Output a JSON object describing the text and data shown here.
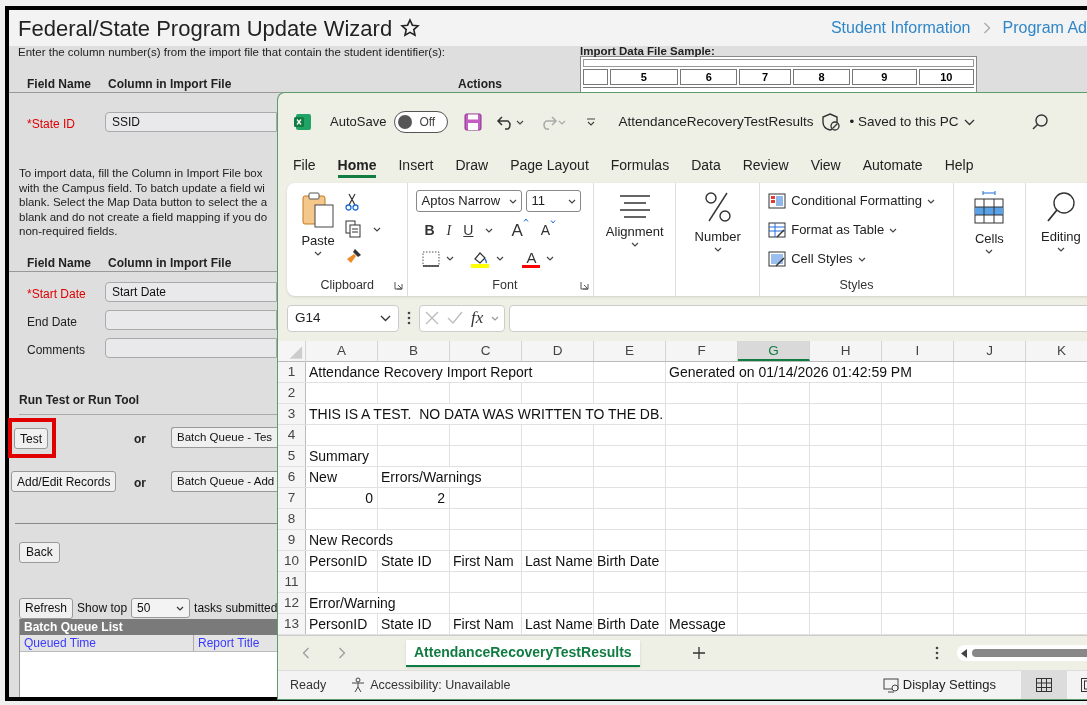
{
  "page": {
    "title": "Federal/State Program Update Wizard",
    "breadcrumb": [
      "Student Information",
      "Program Ad"
    ]
  },
  "intro": "Enter the column number(s) from the import file that contain the student identifier(s):",
  "sample": {
    "title": "Import Data File Sample:",
    "columns": [
      "5",
      "6",
      "7",
      "8",
      "9",
      "10"
    ]
  },
  "identifier_section": {
    "headers": [
      "Field Name",
      "Column in Import File",
      "Actions"
    ],
    "fields": [
      {
        "label": "*State ID",
        "required": true,
        "value": "SSID"
      }
    ]
  },
  "instructions": [
    "To import data, fill the Column in Import File box",
    "with the Campus field. To batch update a field wi",
    "blank. Select the Map Data button to select the a",
    "blank and do not create a field mapping if you do",
    "non-required fields."
  ],
  "mapping_section": {
    "headers": [
      "Field Name",
      "Column in Import File"
    ],
    "fields": [
      {
        "label": "*Start Date",
        "required": true,
        "value": "Start Date"
      },
      {
        "label": "End Date",
        "required": false
      },
      {
        "label": "Comments",
        "required": false
      }
    ]
  },
  "run_section": {
    "title": "Run Test or Run Tool",
    "rows": [
      {
        "button": "Test",
        "highlighted": true,
        "separator": "or",
        "batch_button": "Batch Queue - Tes"
      },
      {
        "button": "Add/Edit Records",
        "highlighted": false,
        "separator": "or",
        "batch_button": "Batch Queue - Add"
      }
    ]
  },
  "back_button": "Back",
  "queue": {
    "refresh": "Refresh",
    "show_top": "Show top",
    "count": "50",
    "suffix": "tasks submitted",
    "title": "Batch Queue List",
    "columns": [
      "Queued Time",
      "Report Title"
    ]
  },
  "excel": {
    "autosave": {
      "label": "AutoSave",
      "on": false,
      "state_text": "Off"
    },
    "filename": "AttendanceRecoveryTestResults",
    "save_status": "• Saved to this PC",
    "tabs": [
      {
        "label": "File",
        "selected": false
      },
      {
        "label": "Home",
        "selected": true
      },
      {
        "label": "Insert",
        "selected": false
      },
      {
        "label": "Draw",
        "selected": false
      },
      {
        "label": "Page Layout",
        "selected": false
      },
      {
        "label": "Formulas",
        "selected": false
      },
      {
        "label": "Data",
        "selected": false
      },
      {
        "label": "Review",
        "selected": false
      },
      {
        "label": "View",
        "selected": false
      },
      {
        "label": "Automate",
        "selected": false
      },
      {
        "label": "Help",
        "selected": false
      }
    ],
    "ribbon": {
      "paste": "Paste",
      "clipboard": "Clipboard",
      "font_name": "Aptos Narrow",
      "font_size": "11",
      "format_buttons": [
        "B",
        "I",
        "U"
      ],
      "grow": "A",
      "shrink": "A",
      "font_color": "A",
      "font": "Font",
      "alignment": "Alignment",
      "number": "Number",
      "styles_items": [
        "Conditional Formatting",
        "Format as Table",
        "Cell Styles"
      ],
      "styles": "Styles",
      "cells": "Cells",
      "editing": "Editing"
    },
    "name_box": "G14",
    "function_label": "fx",
    "columns": [
      {
        "letter": "A",
        "selected": false
      },
      {
        "letter": "B",
        "selected": false
      },
      {
        "letter": "C",
        "selected": false
      },
      {
        "letter": "D",
        "selected": false
      },
      {
        "letter": "E",
        "selected": false
      },
      {
        "letter": "F",
        "selected": false
      },
      {
        "letter": "G",
        "selected": true
      },
      {
        "letter": "H",
        "selected": false
      },
      {
        "letter": "I",
        "selected": false
      },
      {
        "letter": "J",
        "selected": false
      },
      {
        "letter": "K",
        "selected": false
      }
    ],
    "rows": [
      {
        "number": "1",
        "cells": {
          "A": {
            "text": "Attendance Recovery Import Report",
            "kind": "text"
          },
          "F": {
            "text": "Generated on 01/14/2026 01:42:59 PM",
            "kind": "text"
          }
        }
      },
      {
        "number": "2",
        "cells": {}
      },
      {
        "number": "3",
        "cells": {
          "A": {
            "text": "THIS IS A TEST.  NO DATA WAS WRITTEN TO THE DB.",
            "kind": "text"
          }
        }
      },
      {
        "number": "4",
        "cells": {}
      },
      {
        "number": "5",
        "cells": {
          "A": {
            "text": "Summary",
            "kind": "text"
          }
        }
      },
      {
        "number": "6",
        "cells": {
          "A": {
            "text": "New",
            "kind": "text"
          },
          "B": {
            "text": "Errors/Warnings",
            "kind": "text"
          }
        }
      },
      {
        "number": "7",
        "cells": {
          "A": {
            "text": "0",
            "kind": "number"
          },
          "B": {
            "text": "2",
            "kind": "number"
          }
        }
      },
      {
        "number": "8",
        "cells": {}
      },
      {
        "number": "9",
        "cells": {
          "A": {
            "text": "New Records",
            "kind": "text"
          }
        }
      },
      {
        "number": "10",
        "cells": {
          "A": {
            "text": "PersonID",
            "kind": "text"
          },
          "B": {
            "text": "State ID",
            "kind": "text"
          },
          "C": {
            "text": "First Nam",
            "kind": "text"
          },
          "D": {
            "text": "Last Name",
            "kind": "text"
          },
          "E": {
            "text": "Birth Date",
            "kind": "text"
          }
        }
      },
      {
        "number": "11",
        "cells": {}
      },
      {
        "number": "12",
        "cells": {
          "A": {
            "text": "Error/Warning",
            "kind": "text"
          }
        }
      },
      {
        "number": "13",
        "cells": {
          "A": {
            "text": "PersonID",
            "kind": "text"
          },
          "B": {
            "text": "State ID",
            "kind": "text"
          },
          "C": {
            "text": "First Nam",
            "kind": "text"
          },
          "D": {
            "text": "Last Name",
            "kind": "text"
          },
          "E": {
            "text": "Birth Date",
            "kind": "text"
          },
          "F": {
            "text": "Message",
            "kind": "text"
          }
        }
      }
    ],
    "sheet_tabs": [
      {
        "name": "AttendanceRecoveryTestResults",
        "selected": true
      }
    ],
    "status": {
      "ready": "Ready",
      "accessibility": "Accessibility: Unavailable",
      "display": "Display Settings"
    }
  }
}
